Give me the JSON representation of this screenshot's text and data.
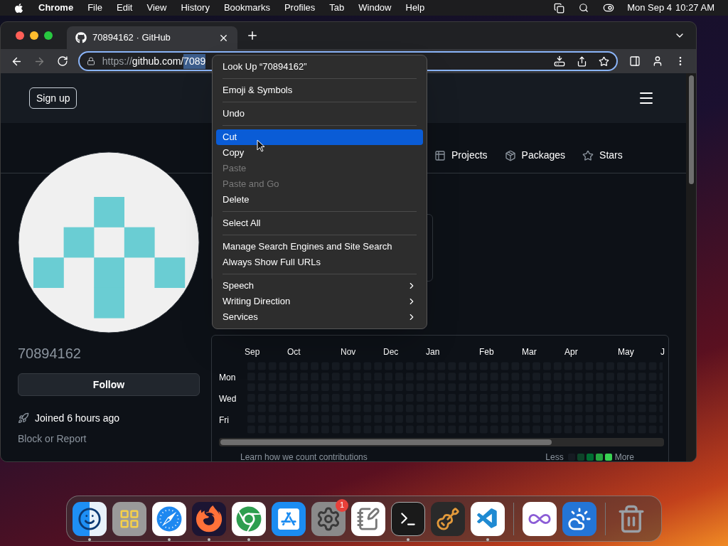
{
  "menu_bar": {
    "app": "Chrome",
    "menus": [
      "File",
      "Edit",
      "View",
      "History",
      "Bookmarks",
      "Profiles",
      "Tab",
      "Window",
      "Help"
    ],
    "date": "Mon Sep 4",
    "time": "10:27 AM"
  },
  "browser": {
    "tabs": [
      {
        "title": "70894162 · GitHub",
        "selected": true
      }
    ],
    "address": {
      "scheme": "https://",
      "host": "github.com/",
      "selected_text": "7089"
    }
  },
  "page": {
    "header": {
      "sign_up": "Sign up"
    },
    "nav": [
      {
        "kind": "projects",
        "label": "Projects"
      },
      {
        "kind": "packages",
        "label": "Packages"
      },
      {
        "kind": "stars",
        "label": "Stars"
      }
    ],
    "profile": {
      "username": "70894162",
      "follow": "Follow",
      "joined": "Joined 6 hours ago",
      "block": "Block or Report"
    },
    "contributions": {
      "months": [
        "Sep",
        "Oct",
        "Nov",
        "Dec",
        "Jan",
        "Feb",
        "Mar",
        "Apr",
        "May",
        "J"
      ],
      "days": [
        "Mon",
        "Wed",
        "Fri"
      ],
      "learn": "Learn how we count contributions",
      "less": "Less",
      "more": "More",
      "legend": [
        {
          "color": "#161b22"
        },
        {
          "color": "#0e4429"
        },
        {
          "color": "#006d32"
        },
        {
          "color": "#26a641"
        },
        {
          "color": "#39d353"
        }
      ]
    }
  },
  "context_menu": {
    "groups": [
      [
        {
          "label": "Look Up “70894162”",
          "disabled": false,
          "selected": false,
          "submenu": false
        }
      ],
      [
        {
          "label": "Emoji & Symbols",
          "disabled": false,
          "selected": false,
          "submenu": false
        }
      ],
      [
        {
          "label": "Undo",
          "disabled": false,
          "selected": false,
          "submenu": false
        }
      ],
      [
        {
          "label": "Cut",
          "disabled": false,
          "selected": true,
          "submenu": false
        },
        {
          "label": "Copy",
          "disabled": false,
          "selected": false,
          "submenu": false
        },
        {
          "label": "Paste",
          "disabled": true,
          "selected": false,
          "submenu": false
        },
        {
          "label": "Paste and Go",
          "disabled": true,
          "selected": false,
          "submenu": false
        },
        {
          "label": "Delete",
          "disabled": false,
          "selected": false,
          "submenu": false
        }
      ],
      [
        {
          "label": "Select All",
          "disabled": false,
          "selected": false,
          "submenu": false
        }
      ],
      [
        {
          "label": "Manage Search Engines and Site Search",
          "disabled": false,
          "selected": false,
          "submenu": false
        },
        {
          "label": "Always Show Full URLs",
          "disabled": false,
          "selected": false,
          "submenu": false
        }
      ],
      [
        {
          "label": "Speech",
          "disabled": false,
          "selected": false,
          "submenu": true
        },
        {
          "label": "Writing Direction",
          "disabled": false,
          "selected": false,
          "submenu": true
        },
        {
          "label": "Services",
          "disabled": false,
          "selected": false,
          "submenu": true
        }
      ]
    ]
  },
  "dock": {
    "groups": [
      [
        {
          "running": true
        },
        {
          "running": false
        },
        {
          "running": true
        },
        {
          "running": true
        },
        {
          "running": true
        },
        {
          "running": false
        },
        {
          "running": false,
          "badge": "1"
        },
        {
          "running": false
        },
        {
          "running": true
        },
        {
          "running": false
        },
        {
          "running": true
        }
      ],
      [
        {
          "running": false
        },
        {
          "running": false
        }
      ],
      [
        {
          "running": false
        }
      ]
    ]
  }
}
